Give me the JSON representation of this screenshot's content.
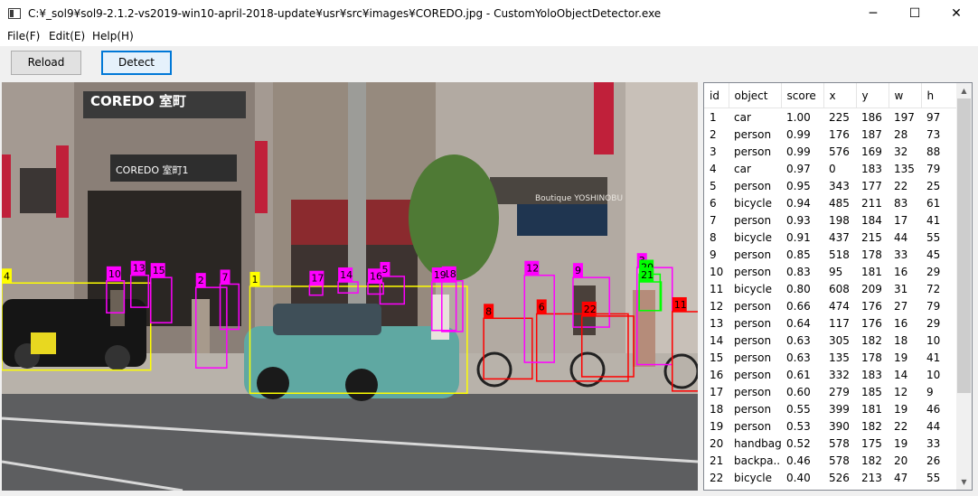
{
  "window": {
    "title": "C:¥_sol9¥sol9-2.1.2-vs2019-win10-april-2018-update¥usr¥src¥images¥COREDO.jpg - CustomYoloObjectDetector.exe",
    "minimize_glyph": "─",
    "maximize_glyph": "☐",
    "close_glyph": "✕"
  },
  "menu": {
    "file": "File(F)",
    "edit": "Edit(E)",
    "help": "Help(H)"
  },
  "toolbar": {
    "reload_label": "Reload",
    "detect_label": "Detect"
  },
  "image": {
    "sign_coredo": "COREDO 室町",
    "sign_coredo_kanji": "COREDO 室町1",
    "sign_coredo_vertical": "COREDO",
    "sign_shop": "Boutique YOSHINOBU",
    "colors": {
      "car": "#ffff00",
      "person": "#ff00ff",
      "bicycle": "#ff0000",
      "handbag": "#00ff00",
      "backpack": "#00ff00"
    }
  },
  "table": {
    "columns": [
      "id",
      "object",
      "score",
      "x",
      "y",
      "w",
      "h"
    ],
    "rows": [
      [
        "1",
        "car",
        "1.00",
        "225",
        "186",
        "197",
        "97"
      ],
      [
        "2",
        "person",
        "0.99",
        "176",
        "187",
        "28",
        "73"
      ],
      [
        "3",
        "person",
        "0.99",
        "576",
        "169",
        "32",
        "88"
      ],
      [
        "4",
        "car",
        "0.97",
        "0",
        "183",
        "135",
        "79"
      ],
      [
        "5",
        "person",
        "0.95",
        "343",
        "177",
        "22",
        "25"
      ],
      [
        "6",
        "bicycle",
        "0.94",
        "485",
        "211",
        "83",
        "61"
      ],
      [
        "7",
        "person",
        "0.93",
        "198",
        "184",
        "17",
        "41"
      ],
      [
        "8",
        "bicycle",
        "0.91",
        "437",
        "215",
        "44",
        "55"
      ],
      [
        "9",
        "person",
        "0.85",
        "518",
        "178",
        "33",
        "45"
      ],
      [
        "10",
        "person",
        "0.83",
        "95",
        "181",
        "16",
        "29"
      ],
      [
        "11",
        "bicycle",
        "0.80",
        "608",
        "209",
        "31",
        "72"
      ],
      [
        "12",
        "person",
        "0.66",
        "474",
        "176",
        "27",
        "79"
      ],
      [
        "13",
        "person",
        "0.64",
        "117",
        "176",
        "16",
        "29"
      ],
      [
        "14",
        "person",
        "0.63",
        "305",
        "182",
        "18",
        "10"
      ],
      [
        "15",
        "person",
        "0.63",
        "135",
        "178",
        "19",
        "41"
      ],
      [
        "16",
        "person",
        "0.61",
        "332",
        "183",
        "14",
        "10"
      ],
      [
        "17",
        "person",
        "0.60",
        "279",
        "185",
        "12",
        "9"
      ],
      [
        "18",
        "person",
        "0.55",
        "399",
        "181",
        "19",
        "46"
      ],
      [
        "19",
        "person",
        "0.53",
        "390",
        "182",
        "22",
        "44"
      ],
      [
        "20",
        "handbag",
        "0.52",
        "578",
        "175",
        "19",
        "33"
      ],
      [
        "21",
        "backpa...",
        "0.46",
        "578",
        "182",
        "20",
        "26"
      ],
      [
        "22",
        "bicycle",
        "0.40",
        "526",
        "213",
        "47",
        "55"
      ]
    ]
  }
}
